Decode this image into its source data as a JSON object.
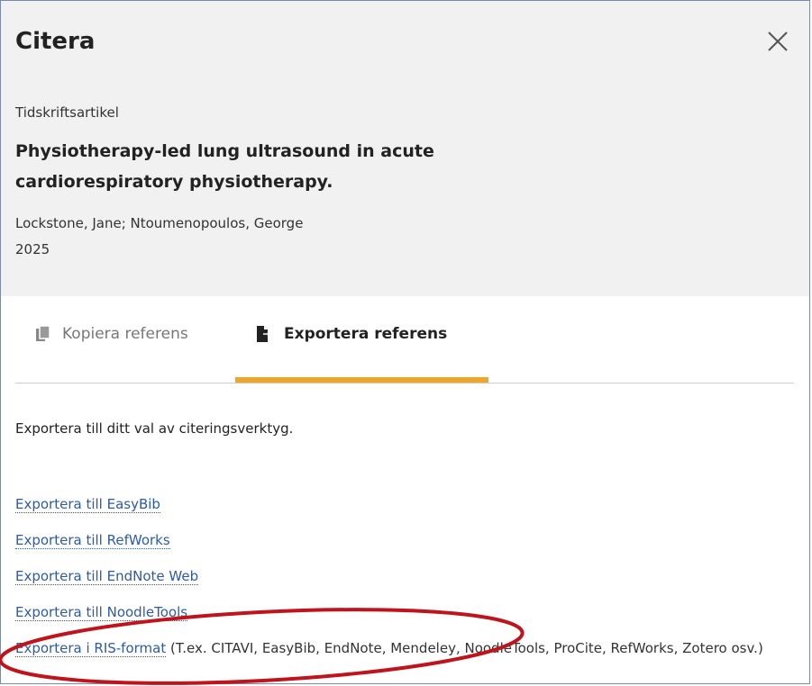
{
  "dialog": {
    "title": "Citera"
  },
  "record": {
    "type": "Tidskriftsartikel",
    "title": "Physiotherapy-led lung ultrasound in acute cardiorespiratory physiotherapy.",
    "authors": "Lockstone, Jane; Ntoumenopoulos, George",
    "year": "2025"
  },
  "tabs": [
    {
      "label": "Kopiera referens",
      "icon": "copy-icon",
      "active": false
    },
    {
      "label": "Exportera referens",
      "icon": "export-icon",
      "active": true
    }
  ],
  "export": {
    "intro": "Exportera till ditt val av citeringsverktyg.",
    "links": [
      {
        "label": "Exportera till EasyBib"
      },
      {
        "label": "Exportera till RefWorks"
      },
      {
        "label": "Exportera till EndNote Web"
      },
      {
        "label": "Exportera till NoodleTools"
      },
      {
        "label": "Exportera i RIS-format",
        "note": "(T.ex. CITAVI, EasyBib, EndNote, Mendeley, NoodleTools, ProCite, RefWorks, Zotero osv.)"
      }
    ]
  },
  "colors": {
    "accent": "#f0a526",
    "link": "#2e5aa8",
    "annotation": "#c0141c",
    "header_bg": "#f1f1f1"
  }
}
